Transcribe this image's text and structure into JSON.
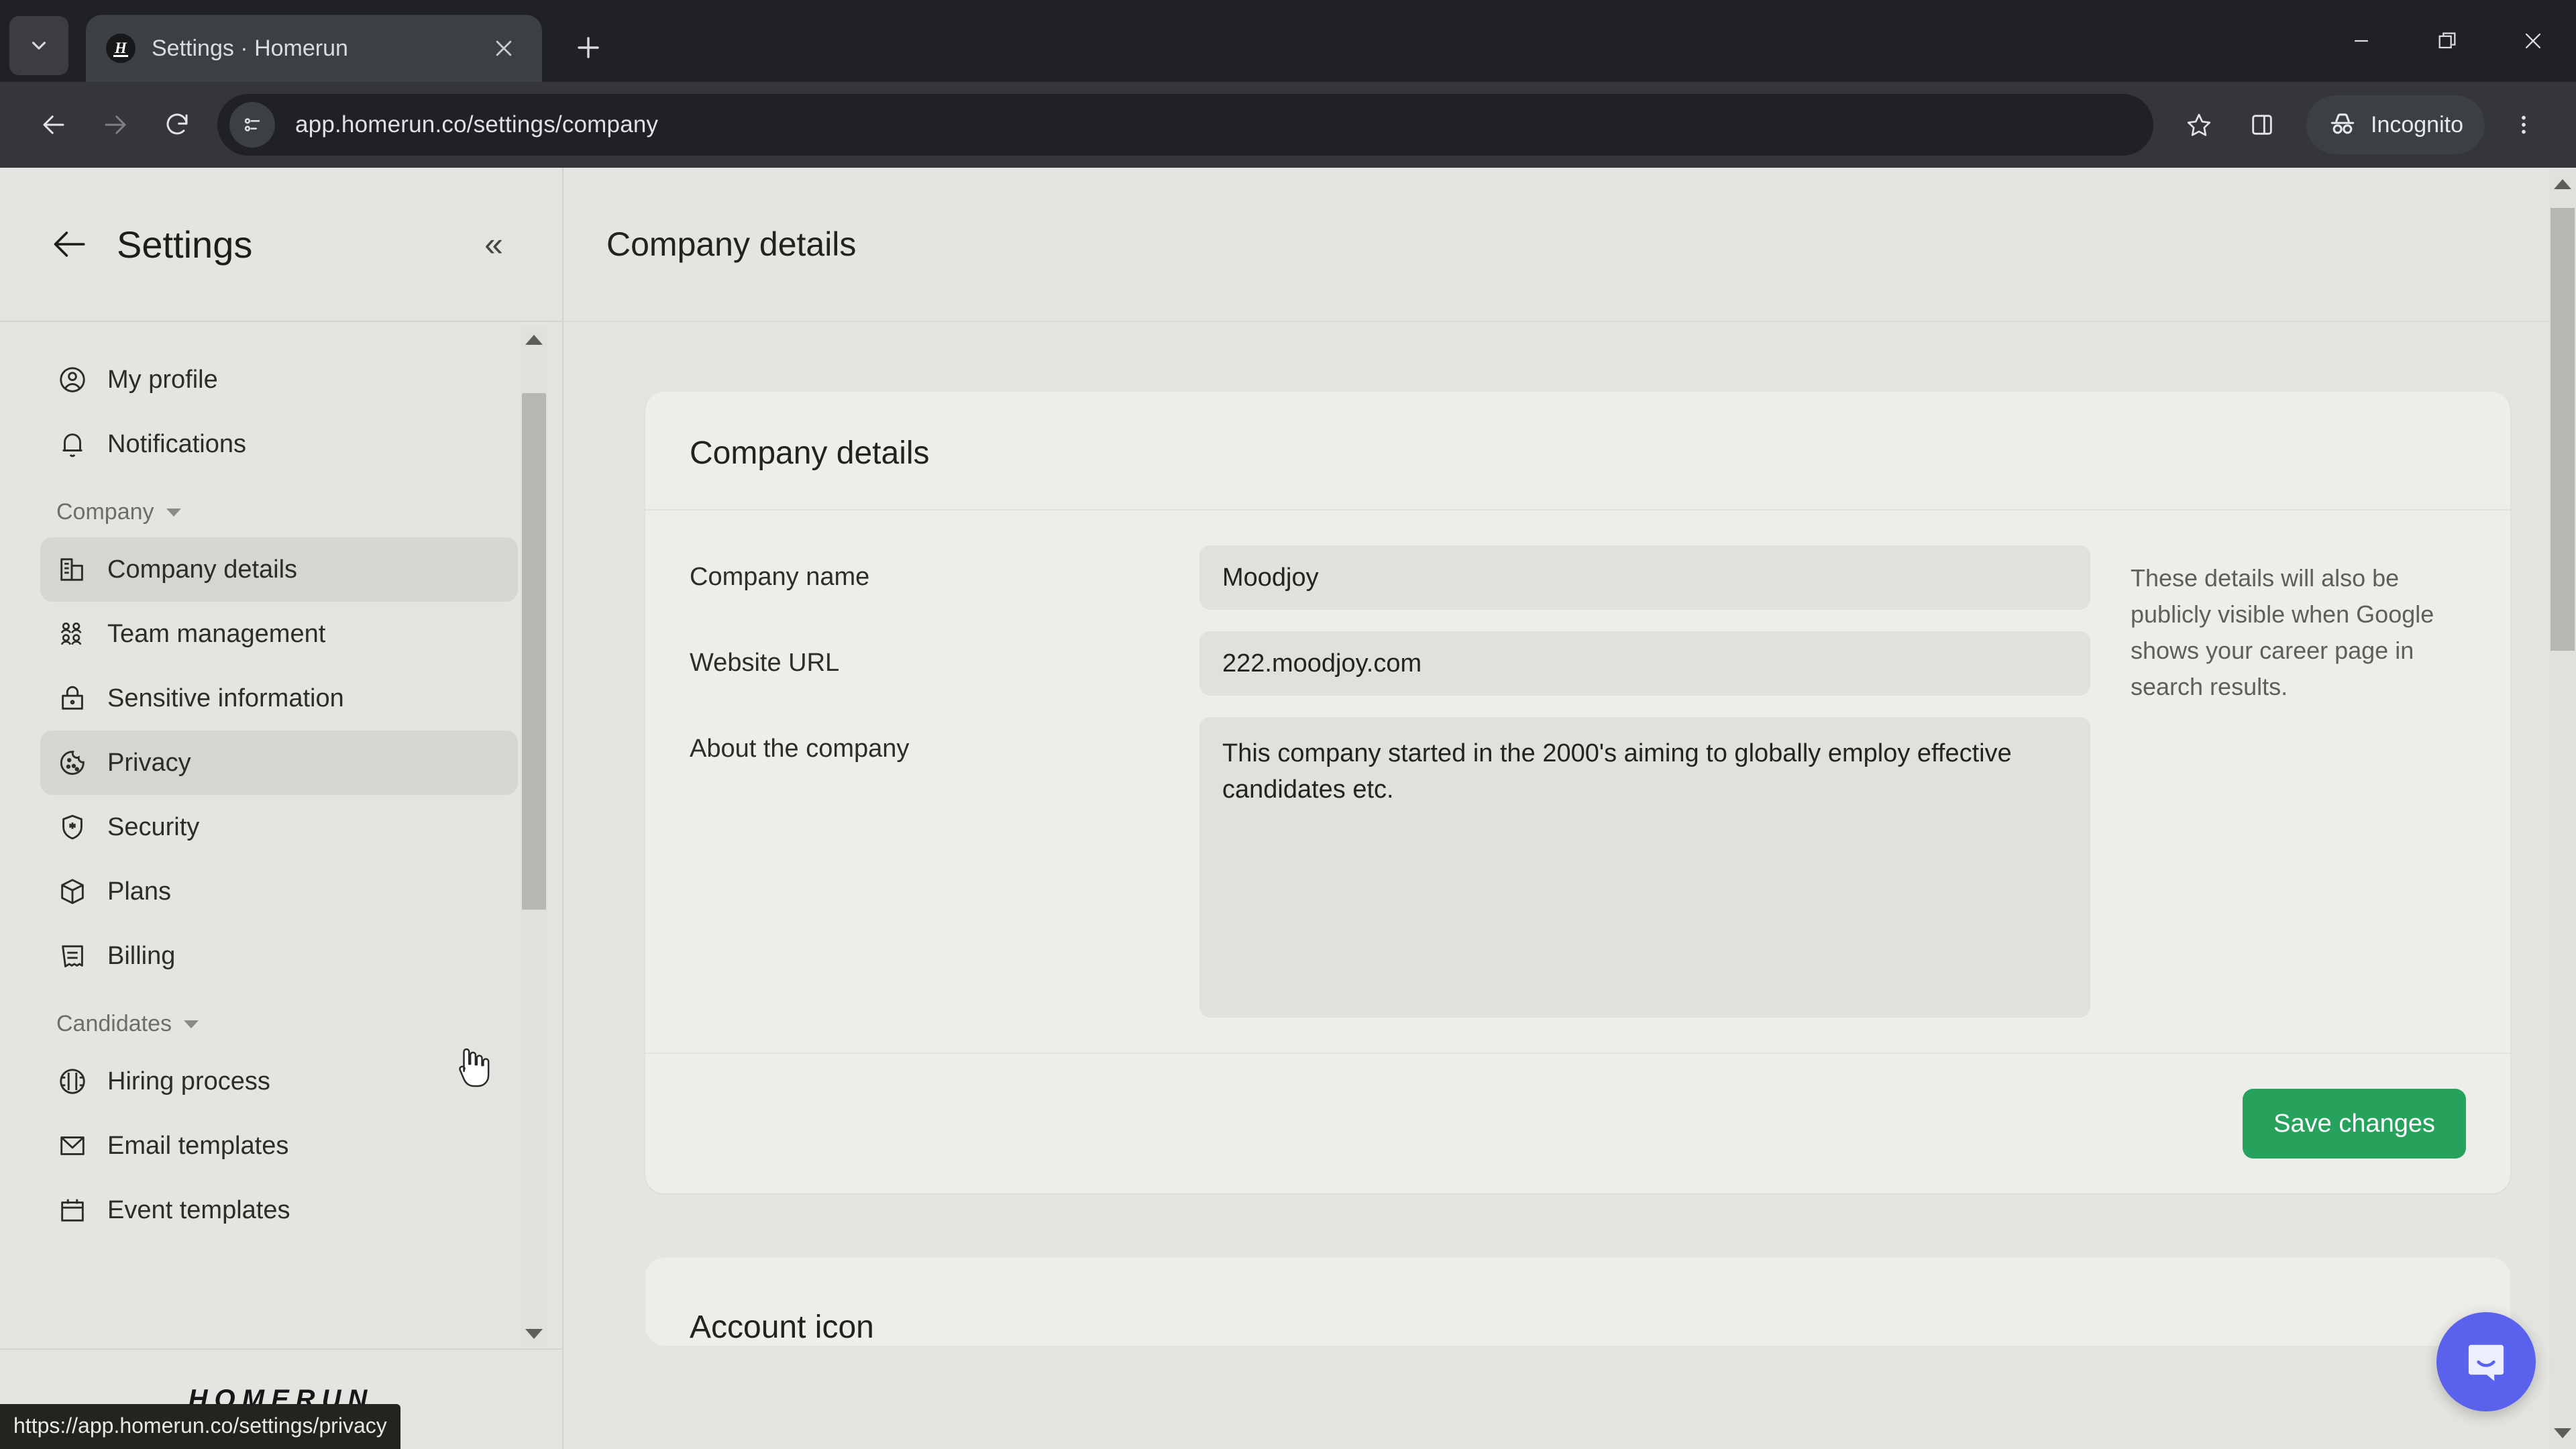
{
  "browser": {
    "tab": {
      "title": "Settings · Homerun",
      "favicon_letter": "H"
    },
    "tab_search_icon": "chevron-down-icon",
    "new_tab_label": "+",
    "close_tab_label": "×",
    "window_controls": {
      "minimize": "minimize-icon",
      "maximize": "restore-icon",
      "close": "close-icon"
    },
    "nav": {
      "back": "back-arrow-icon",
      "forward": "forward-arrow-icon",
      "reload": "reload-icon"
    },
    "omnibox": {
      "url": "app.homerun.co/settings/company",
      "site_info_icon": "page-info-icon"
    },
    "actions": {
      "bookmark_icon": "star-icon",
      "side_panel_icon": "side-panel-icon",
      "incognito_label": "Incognito",
      "incognito_icon": "incognito-hat-icon",
      "menu_icon": "three-dot-menu-icon"
    }
  },
  "sidebar": {
    "back_icon": "back-arrow-icon",
    "title": "Settings",
    "collapse_icon": "double-chevron-left-icon",
    "top_items": [
      {
        "label": "My profile",
        "icon": "user-circle-icon",
        "active": false
      },
      {
        "label": "Notifications",
        "icon": "bell-icon",
        "active": false
      }
    ],
    "groups": [
      {
        "label": "Company",
        "caret": "caret-down-icon",
        "items": [
          {
            "label": "Company details",
            "icon": "building-icon",
            "active": true
          },
          {
            "label": "Team management",
            "icon": "people-icon",
            "active": false
          },
          {
            "label": "Sensitive information",
            "icon": "lock-icon",
            "active": false
          },
          {
            "label": "Privacy",
            "icon": "cookie-icon",
            "active": true
          },
          {
            "label": "Security",
            "icon": "shield-star-icon",
            "active": false
          },
          {
            "label": "Plans",
            "icon": "box-icon",
            "active": false
          },
          {
            "label": "Billing",
            "icon": "receipt-icon",
            "active": false
          }
        ]
      },
      {
        "label": "Candidates",
        "caret": "caret-down-icon",
        "items": [
          {
            "label": "Hiring process",
            "icon": "flow-circle-icon",
            "active": false
          },
          {
            "label": "Email templates",
            "icon": "envelope-icon",
            "active": false
          },
          {
            "label": "Event templates",
            "icon": "calendar-icon",
            "active": false
          }
        ]
      }
    ],
    "logo": "HOMERUN"
  },
  "main": {
    "header_title": "Company details",
    "card": {
      "title": "Company details",
      "fields": [
        {
          "label": "Company name",
          "value": "Moodjoy",
          "type": "text"
        },
        {
          "label": "Website URL",
          "value": "222.moodjoy.com",
          "type": "text"
        },
        {
          "label": "About the company",
          "value": "This company started in the 2000's aiming to globally employ effective candidates etc.",
          "type": "textarea"
        }
      ],
      "helper_text": "These details will also be publicly visible when Google shows your career page in search results.",
      "save_label": "Save changes",
      "save_color": "#27a25d"
    },
    "next_section_title": "Account icon"
  },
  "overlays": {
    "status_url": "https://app.homerun.co/settings/privacy",
    "intercom": {
      "icon": "chat-bubble-icon",
      "color": "#5a62ed"
    },
    "cursor": "pointer-hand-cursor"
  }
}
